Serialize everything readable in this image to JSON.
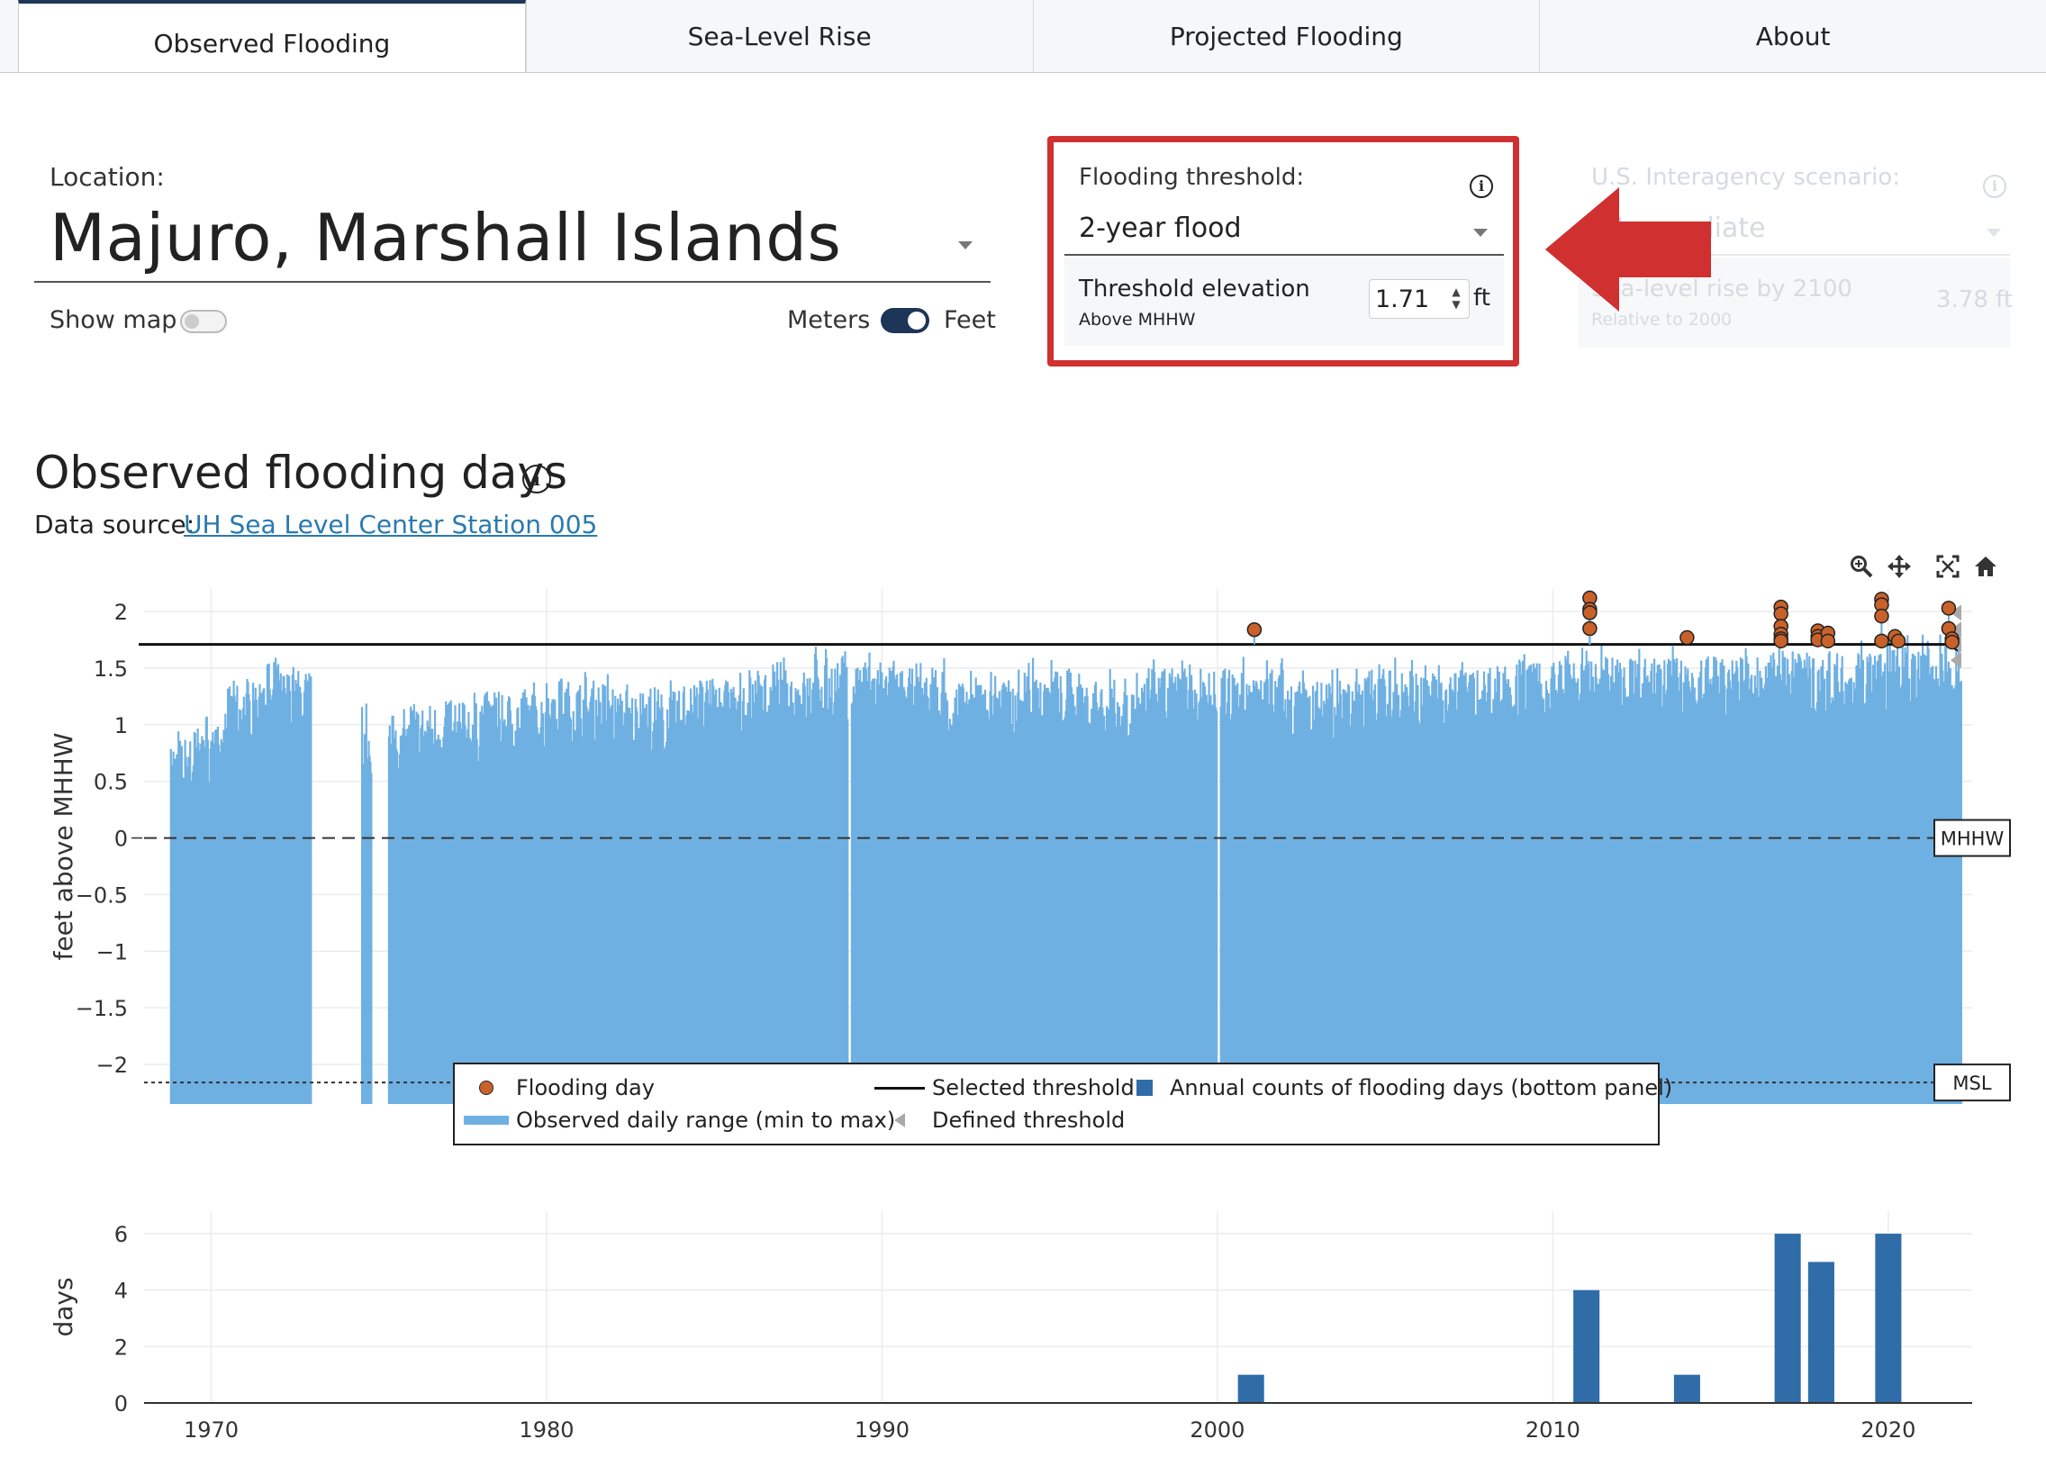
{
  "tabs": [
    {
      "label": "Observed Flooding",
      "active": true
    },
    {
      "label": "Sea-Level Rise",
      "active": false
    },
    {
      "label": "Projected Flooding",
      "active": false
    },
    {
      "label": "About",
      "active": false
    }
  ],
  "location": {
    "label": "Location:",
    "value": "Majuro, Marshall Islands",
    "show_map_label": "Show map",
    "show_map_on": false,
    "units_left": "Meters",
    "units_right": "Feet",
    "units_feet_selected": true
  },
  "threshold": {
    "label": "Flooding threshold:",
    "selected": "2-year flood",
    "elevation_label": "Threshold elevation",
    "elevation_sub": "Above MHHW",
    "elevation_value": "1.71",
    "unit": "ft"
  },
  "scenario": {
    "label": "U.S. Interagency scenario:",
    "selected": "Intermediate",
    "slr_label": "Sea-level rise by 2100",
    "slr_sub": "Relative to 2000",
    "slr_value": "3.78 ft"
  },
  "section": {
    "title": "Observed flooding days",
    "data_source_label": "Data source:",
    "data_source_link": "UH Sea Level Center Station 005"
  },
  "colors": {
    "range_fill": "#6fb0e2",
    "flood_dot": "#c8622a",
    "annual_bar": "#2f6ca8",
    "tab_accent": "#1d3557",
    "highlight": "#d03030"
  },
  "modebar_icons": [
    "zoom-icon",
    "pan-icon",
    "autoscale-icon",
    "home-icon"
  ],
  "legend": {
    "flooding_day": "Flooding day",
    "observed_range": "Observed daily range (min to max)",
    "selected_threshold": "Selected threshold",
    "defined_threshold": "Defined threshold",
    "annual_counts": "Annual counts of flooding days (bottom panel)"
  },
  "chart_data": [
    {
      "type": "area",
      "ylabel": "feet above MHHW",
      "ylim": [
        -2.35,
        2.2
      ],
      "xlim": [
        1968.0,
        2022.5
      ],
      "yticks": [
        2,
        1.5,
        1,
        0.5,
        0,
        -0.5,
        -1,
        -1.5,
        -2
      ],
      "ytick_labels": [
        "2",
        "1.5",
        "1",
        "0.5",
        "0",
        "−0.5",
        "−1",
        "−1.5",
        "−2"
      ],
      "selected_threshold": 1.71,
      "reference_lines": [
        {
          "name": "MHHW",
          "y": 0
        },
        {
          "name": "MSL",
          "y": -2.16
        }
      ],
      "data_periods": [
        [
          1968.8,
          1973.0
        ],
        [
          1974.5,
          1974.8
        ],
        [
          1975.3,
          1989.0
        ],
        [
          1989.1,
          2000.0
        ],
        [
          2000.1,
          2022.2
        ]
      ],
      "range_min": -2.35,
      "typical_max_by_year": [
        [
          1969,
          0.7
        ],
        [
          1970,
          0.8
        ],
        [
          1971,
          1.2
        ],
        [
          1972,
          1.3
        ],
        [
          1975,
          0.9
        ],
        [
          1977,
          1.0
        ],
        [
          1979,
          1.1
        ],
        [
          1981,
          1.2
        ],
        [
          1983,
          1.1
        ],
        [
          1985,
          1.2
        ],
        [
          1987,
          1.3
        ],
        [
          1989,
          1.4
        ],
        [
          1991,
          1.3
        ],
        [
          1993,
          1.2
        ],
        [
          1995,
          1.3
        ],
        [
          1997,
          1.2
        ],
        [
          1999,
          1.3
        ],
        [
          2001,
          1.3
        ],
        [
          2003,
          1.2
        ],
        [
          2005,
          1.3
        ],
        [
          2007,
          1.3
        ],
        [
          2009,
          1.35
        ],
        [
          2011,
          1.4
        ],
        [
          2013,
          1.4
        ],
        [
          2015,
          1.4
        ],
        [
          2017,
          1.45
        ],
        [
          2019,
          1.45
        ],
        [
          2021,
          1.5
        ]
      ],
      "flooding_days": [
        {
          "x": 2001.1,
          "y": 1.84
        },
        {
          "x": 2011.1,
          "y": 2.12
        },
        {
          "x": 2011.1,
          "y": 2.02
        },
        {
          "x": 2011.1,
          "y": 1.99
        },
        {
          "x": 2011.1,
          "y": 1.85
        },
        {
          "x": 2014.0,
          "y": 1.77
        },
        {
          "x": 2016.8,
          "y": 2.04
        },
        {
          "x": 2016.8,
          "y": 1.98
        },
        {
          "x": 2016.8,
          "y": 1.87
        },
        {
          "x": 2016.8,
          "y": 1.8
        },
        {
          "x": 2016.8,
          "y": 1.76
        },
        {
          "x": 2016.8,
          "y": 1.74
        },
        {
          "x": 2017.9,
          "y": 1.83
        },
        {
          "x": 2017.9,
          "y": 1.78
        },
        {
          "x": 2017.9,
          "y": 1.75
        },
        {
          "x": 2018.2,
          "y": 1.81
        },
        {
          "x": 2018.2,
          "y": 1.74
        },
        {
          "x": 2019.8,
          "y": 2.11
        },
        {
          "x": 2019.8,
          "y": 2.06
        },
        {
          "x": 2019.8,
          "y": 1.96
        },
        {
          "x": 2019.8,
          "y": 1.74
        },
        {
          "x": 2020.2,
          "y": 1.78
        },
        {
          "x": 2020.3,
          "y": 1.74
        },
        {
          "x": 2021.8,
          "y": 2.03
        },
        {
          "x": 2021.8,
          "y": 1.85
        },
        {
          "x": 2021.9,
          "y": 1.76
        },
        {
          "x": 2021.9,
          "y": 1.73
        }
      ],
      "defined_thresholds": [
        1.99,
        1.84,
        1.71,
        1.57
      ]
    },
    {
      "type": "bar",
      "ylabel": "days",
      "ylim": [
        0,
        6.8
      ],
      "yticks": [
        0,
        2,
        4,
        6
      ],
      "xlim": [
        1968.0,
        2022.5
      ],
      "xticks": [
        1970,
        1980,
        1990,
        2000,
        2010,
        2020
      ],
      "x": [
        2001,
        2011,
        2014,
        2017,
        2018,
        2020
      ],
      "values": [
        1,
        4,
        1,
        6,
        5,
        6
      ]
    }
  ]
}
